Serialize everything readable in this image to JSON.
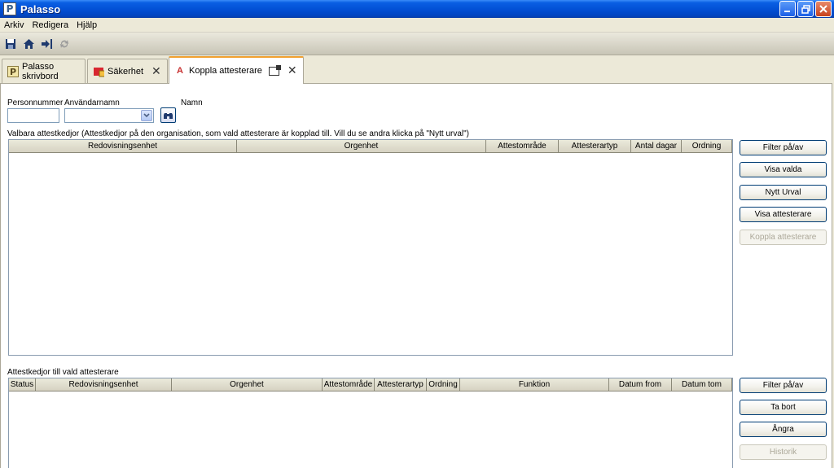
{
  "window": {
    "title": "Palasso",
    "app_icon_letter": "P"
  },
  "menu": [
    "Arkiv",
    "Redigera",
    "Hjälp"
  ],
  "toolbar": [
    "save-icon",
    "home-icon",
    "exit-icon",
    "refresh-icon"
  ],
  "tabs": [
    {
      "label": "Palasso skrivbord",
      "icon": "palasso-icon"
    },
    {
      "label": "Säkerhet",
      "icon": "security-icon"
    },
    {
      "label": "Koppla attesterare",
      "icon": "attest-icon",
      "icon_letter": "A"
    }
  ],
  "filters": {
    "personnummer_label": "Personnummer",
    "personnummer_value": "",
    "anvandarnamn_label": "Användarnamn",
    "anvandarnamn_value": "",
    "namn_label": "Namn"
  },
  "top_grid": {
    "title": "Valbara attestkedjor  (Attestkedjor på den organisation, som vald attesterare är kopplad till. Vill du se andra klicka på \"Nytt urval\")",
    "columns": [
      "Redovisningsenhet",
      "Orgenhet",
      "Attestområde",
      "Attesterartyp",
      "Antal dagar",
      "Ordning"
    ],
    "buttons": [
      {
        "label": "Filter på/av",
        "enabled": true
      },
      {
        "label": "Visa valda",
        "enabled": true
      },
      {
        "label": "Nytt Urval",
        "enabled": true
      },
      {
        "label": "Visa attesterare",
        "enabled": true
      },
      {
        "label": "Koppla attesterare",
        "enabled": false
      }
    ]
  },
  "bottom_grid": {
    "title": "Attestkedjor till vald attesterare",
    "columns": [
      "Status",
      "Redovisningsenhet",
      "Orgenhet",
      "Attestområde",
      "Attesterartyp",
      "Ordning",
      "Funktion",
      "Datum from",
      "Datum tom"
    ],
    "buttons": [
      {
        "label": "Filter på/av",
        "enabled": true
      },
      {
        "label": "Ta bort",
        "enabled": true
      },
      {
        "label": "Ångra",
        "enabled": true
      },
      {
        "label": "Historik",
        "enabled": false
      }
    ]
  }
}
